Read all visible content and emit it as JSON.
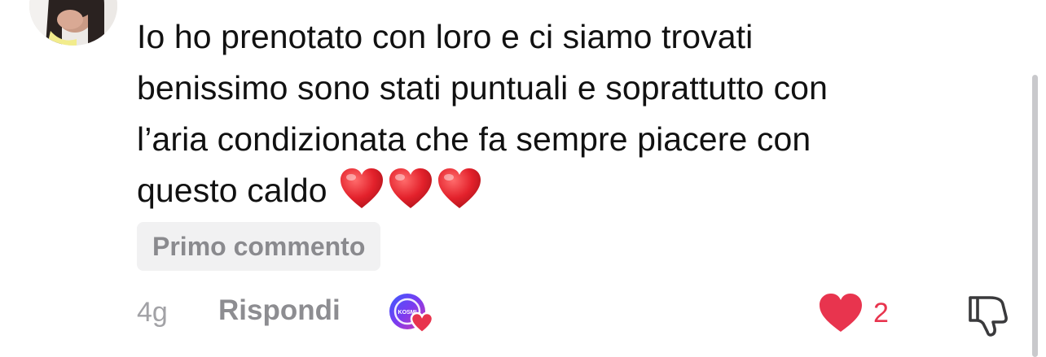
{
  "comment": {
    "lines": [
      "Io ho prenotato con loro e ci siamo trovati",
      "benissimo sono stati puntuali e soprattutto con",
      "l’aria condizionata che fa sempre piacere con",
      "questo caldo"
    ],
    "emoji": [
      "red-heart",
      "red-heart",
      "red-heart"
    ],
    "badge": "Primo commento"
  },
  "footer": {
    "time": "4g",
    "reply_label": "Rispondi",
    "creator_like_logo_text": "KOSMI",
    "like_count": "2",
    "like_color": "#e8344e"
  },
  "colors": {
    "text": "#111111",
    "muted": "#8d8d91",
    "badge_bg": "#f1f1f2",
    "heart": "#e8344e"
  }
}
